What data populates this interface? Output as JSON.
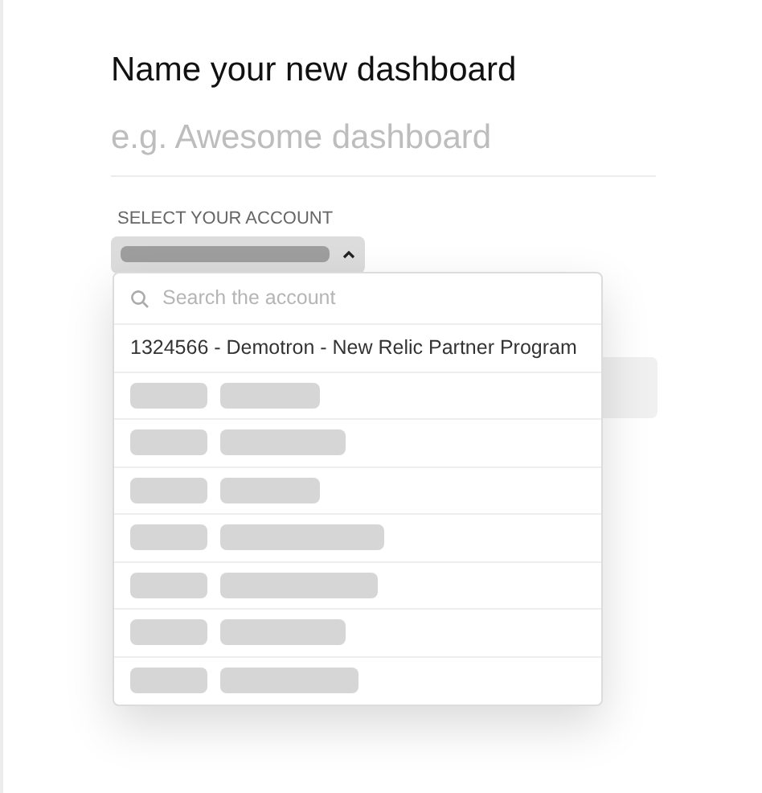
{
  "title": "Name your new dashboard",
  "name_field": {
    "placeholder": "e.g. Awesome dashboard"
  },
  "account_select": {
    "label": "SELECT YOUR ACCOUNT",
    "value_redacted": true,
    "expanded": true,
    "search": {
      "placeholder": "Search the account"
    },
    "options": [
      {
        "kind": "text",
        "label": "1324566 - Demotron - New Relic Partner Program"
      },
      {
        "kind": "redacted"
      },
      {
        "kind": "redacted"
      },
      {
        "kind": "redacted"
      },
      {
        "kind": "redacted"
      },
      {
        "kind": "redacted"
      },
      {
        "kind": "redacted"
      },
      {
        "kind": "redacted"
      }
    ]
  }
}
